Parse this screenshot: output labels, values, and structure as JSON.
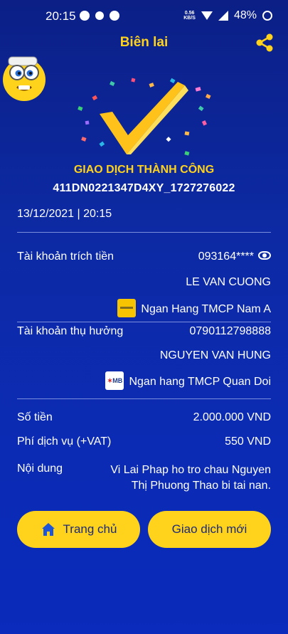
{
  "status_bar": {
    "time": "20:15",
    "net_speed_value": "0.56",
    "net_speed_unit": "KB/S",
    "battery": "48%"
  },
  "header": {
    "title": "Biên lai",
    "share_icon": "share-icon"
  },
  "receipt": {
    "status": "GIAO DỊCH THÀNH CÔNG",
    "transaction_id": "411DN0221347D4XY_1727276022",
    "datetime": "13/12/2021 | 20:15"
  },
  "source": {
    "label": "Tài khoản trích tiền",
    "account": "093164****",
    "name": "LE VAN CUONG",
    "bank": "Ngan Hang TMCP Nam A"
  },
  "beneficiary": {
    "label": "Tài khoản thụ hưởng",
    "account": "0790112798888",
    "name": "NGUYEN VAN HUNG",
    "bank": "Ngan hang TMCP Quan Doi",
    "bank_logo_text": "MB"
  },
  "amounts": {
    "amount_label": "Số tiền",
    "amount": "2.000.000 VND",
    "fee_label": "Phí dịch vụ (+VAT)",
    "fee": "550 VND",
    "content_label": "Nội dung",
    "content_line1": "Vi Lai Phap ho tro chau Nguyen",
    "content_line2": "Thị Phuong Thao bi tai nan."
  },
  "buttons": {
    "home": "Trang chủ",
    "new_transaction": "Giao dịch mới"
  },
  "colors": {
    "accent": "#ffd21c",
    "background": "#0d2aa3"
  }
}
